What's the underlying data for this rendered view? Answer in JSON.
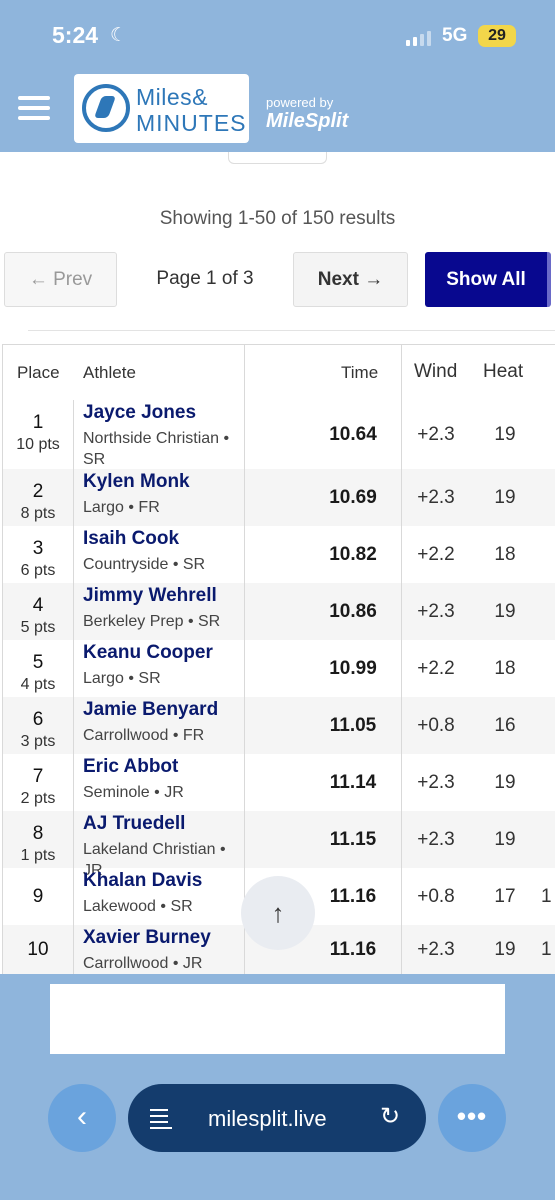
{
  "status": {
    "time": "5:24",
    "network": "5G",
    "battery": "29"
  },
  "header": {
    "logo_line1": "Miles&",
    "logo_line2": "MINUTES",
    "powered_by": "powered by",
    "brand": "MileSplit"
  },
  "pagination": {
    "results_info": "Showing 1-50 of 150 results",
    "prev_label": "← Prev",
    "page_indicator": "Page 1 of 3",
    "next_label": "Next →",
    "show_all_label": "Show All"
  },
  "table": {
    "headers": {
      "place": "Place",
      "athlete": "Athlete",
      "time": "Time",
      "wind": "Wind",
      "heat": "Heat"
    },
    "rows": [
      {
        "place": "1",
        "pts": "10 pts",
        "name": "Jayce Jones",
        "team": "Northside Christian • SR",
        "time": "10.64",
        "wind": "+2.3",
        "heat": "19",
        "extra": ""
      },
      {
        "place": "2",
        "pts": "8 pts",
        "name": "Kylen Monk",
        "team": "Largo • FR",
        "time": "10.69",
        "wind": "+2.3",
        "heat": "19",
        "extra": ""
      },
      {
        "place": "3",
        "pts": "6 pts",
        "name": "Isaih Cook",
        "team": "Countryside • SR",
        "time": "10.82",
        "wind": "+2.2",
        "heat": "18",
        "extra": ""
      },
      {
        "place": "4",
        "pts": "5 pts",
        "name": "Jimmy Wehrell",
        "team": "Berkeley Prep • SR",
        "time": "10.86",
        "wind": "+2.3",
        "heat": "19",
        "extra": ""
      },
      {
        "place": "5",
        "pts": "4 pts",
        "name": "Keanu Cooper",
        "team": "Largo • SR",
        "time": "10.99",
        "wind": "+2.2",
        "heat": "18",
        "extra": ""
      },
      {
        "place": "6",
        "pts": "3 pts",
        "name": "Jamie Benyard",
        "team": "Carrollwood • FR",
        "time": "11.05",
        "wind": "+0.8",
        "heat": "16",
        "extra": ""
      },
      {
        "place": "7",
        "pts": "2 pts",
        "name": "Eric Abbot",
        "team": "Seminole • JR",
        "time": "11.14",
        "wind": "+2.3",
        "heat": "19",
        "extra": ""
      },
      {
        "place": "8",
        "pts": "1 pts",
        "name": "AJ Truedell",
        "team": "Lakeland Christian • JR",
        "time": "11.15",
        "wind": "+2.3",
        "heat": "19",
        "extra": ""
      },
      {
        "place": "9",
        "pts": "",
        "name": "Khalan Davis",
        "team": "Lakewood • SR",
        "time": "11.16",
        "wind": "+0.8",
        "heat": "17",
        "extra": "1"
      },
      {
        "place": "10",
        "pts": "",
        "name": "Xavier Burney",
        "team": "Carrollwood • JR",
        "time": "11.16",
        "wind": "+2.3",
        "heat": "19",
        "extra": "1"
      }
    ]
  },
  "browser": {
    "url": "milesplit.live"
  },
  "colors": {
    "accent": "#08088f",
    "header_bg": "#8fb5dc",
    "url_bar": "#143c6d",
    "link": "#0a1a6e"
  }
}
